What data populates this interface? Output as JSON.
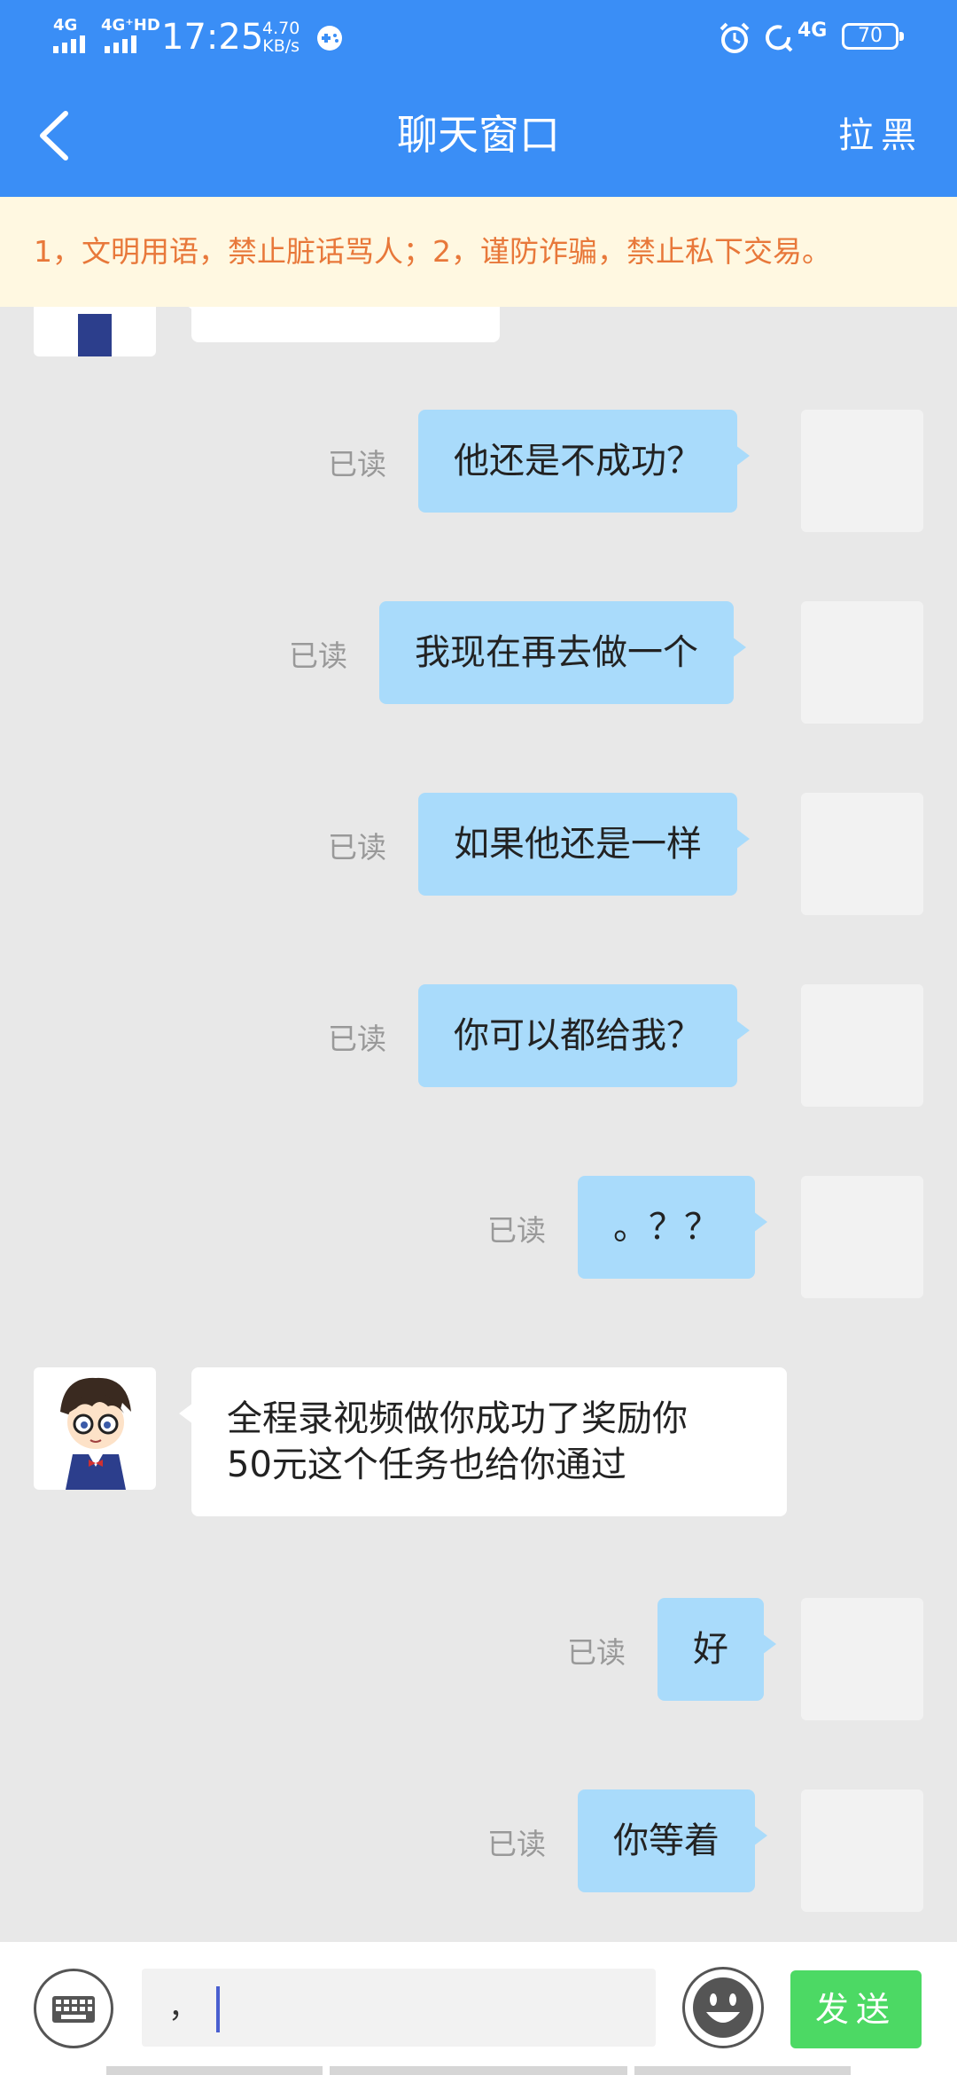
{
  "status_bar": {
    "signal1": "4G",
    "signal2": "4G⁺HD",
    "time": "17:25",
    "speed_value": "4.70",
    "speed_unit": "KB/s",
    "network": "4G",
    "battery": "70"
  },
  "header": {
    "title": "聊天窗口",
    "block_label": "拉黑"
  },
  "notice": "1，文明用语，禁止脏话骂人；2，谨防诈骗，禁止私下交易。",
  "messages": [
    {
      "side": "right",
      "text": "他还是不成功？",
      "status": "已读"
    },
    {
      "side": "right",
      "text": "我现在再去做一个",
      "status": "已读"
    },
    {
      "side": "right",
      "text": "如果他还是一样",
      "status": "已读"
    },
    {
      "side": "right",
      "text": "你可以都给我？",
      "status": "已读"
    },
    {
      "side": "right",
      "text": "。？？",
      "status": "已读"
    },
    {
      "side": "left",
      "line1": "全程录视频做你成功了奖励你",
      "line2": "50元这个任务也给你通过"
    },
    {
      "side": "right",
      "text": "好",
      "status": "已读"
    },
    {
      "side": "right",
      "text": "你等着",
      "status": "已读"
    }
  ],
  "input": {
    "value": "，"
  },
  "send_label": "发送",
  "colors": {
    "header_blue": "#3a8ef6",
    "bubble_blue": "#a9dbfb",
    "notice_text": "#e8783a",
    "send_green": "#4cd964"
  },
  "icons": [
    "back-arrow-icon",
    "keyboard-icon",
    "emoji-smile-icon",
    "alarm-icon",
    "gamepad-icon"
  ]
}
